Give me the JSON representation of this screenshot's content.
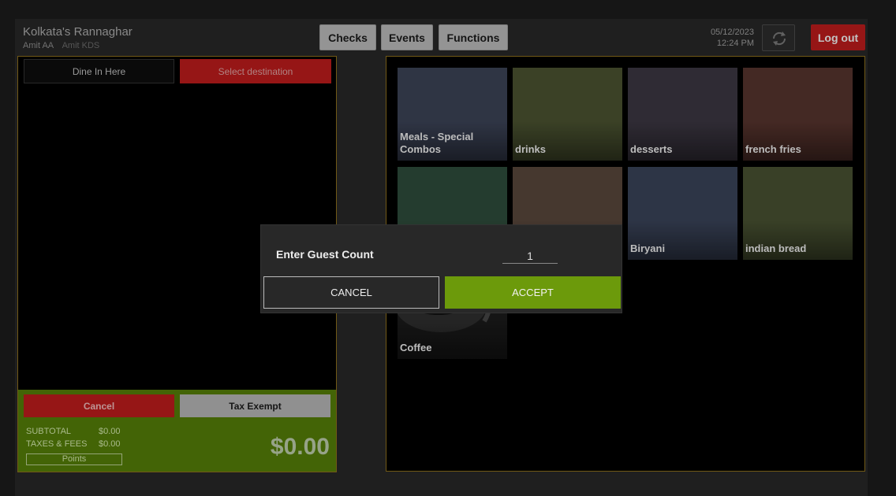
{
  "header": {
    "restaurant_name": "Kolkata's Rannaghar",
    "user": "Amit AA",
    "device": "Amit KDS",
    "nav": {
      "checks": "Checks",
      "events": "Events",
      "functions": "Functions"
    },
    "date": "05/12/2023",
    "time": "12:24 PM",
    "refresh_icon": "refresh-icon",
    "logout": "Log out"
  },
  "order": {
    "dine_in": "Dine In Here",
    "select_destination": "Select destination",
    "cancel": "Cancel",
    "tax_exempt": "Tax Exempt",
    "subtotal_label": "SUBTOTAL",
    "subtotal_value": "$0.00",
    "taxes_label": "TAXES & FEES",
    "taxes_value": "$0.00",
    "points": "Points",
    "total": "$0.00"
  },
  "menu": {
    "tiles": [
      {
        "label": "Meals - Special Combos",
        "color": "#3a4154"
      },
      {
        "label": "drinks",
        "color": "#48502f"
      },
      {
        "label": "desserts",
        "color": "#3a3540"
      },
      {
        "label": "french fries",
        "color": "#54322c"
      },
      {
        "label": "",
        "color": "#2d4a3a"
      },
      {
        "label": "",
        "color": "#56453a"
      },
      {
        "label": "Biryani",
        "color": "#384156"
      },
      {
        "label": "indian bread",
        "color": "#464f30"
      },
      {
        "label": "Coffee",
        "color": "#1f1f1f"
      }
    ]
  },
  "dialog": {
    "title": "Enter Guest Count",
    "guest_count": "1",
    "cancel": "CANCEL",
    "accept": "ACCEPT"
  },
  "colors": {
    "accent_red": "#b71c1c",
    "accent_green": "#6c9a0b",
    "totals_green": "#527a08",
    "panel_border": "#8a6d1c"
  }
}
